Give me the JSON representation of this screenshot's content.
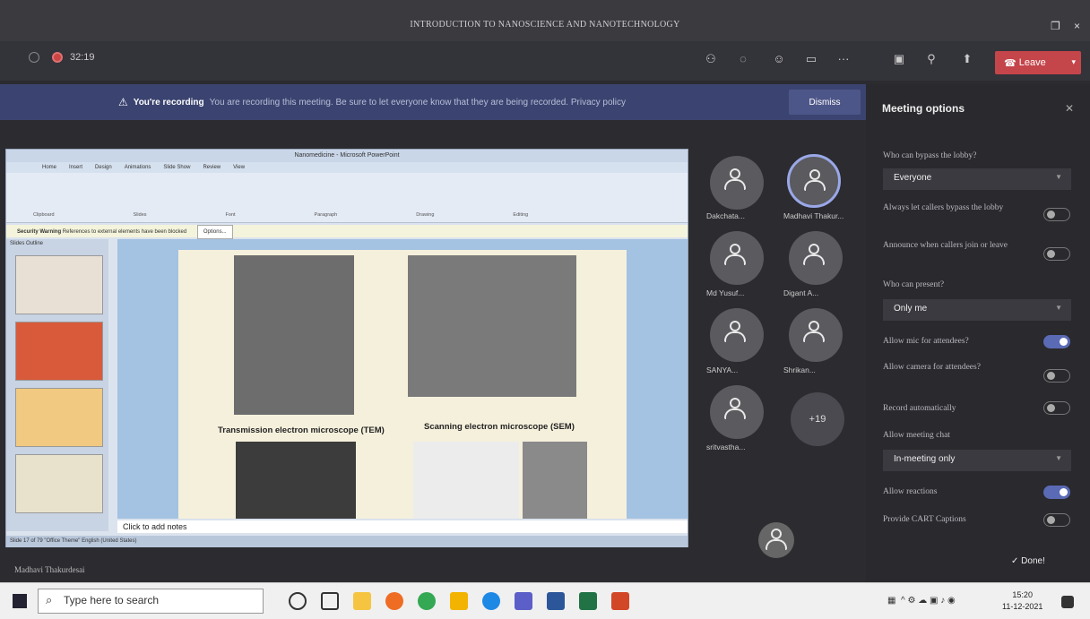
{
  "window": {
    "title": "INTRODUCTION TO NANOSCIENCE AND NANOTECHNOLOGY",
    "restore_icon": "restore-icon",
    "close_glyph": "×"
  },
  "toolbar": {
    "timer": "32:19",
    "leave_label": "Leave",
    "more_glyph": "···"
  },
  "banner": {
    "title": "You're recording",
    "message": "You are recording this meeting. Be sure to let everyone know that they are being recorded. Privacy policy",
    "dismiss": "Dismiss"
  },
  "ppt": {
    "title": "Nanomedicine - Microsoft PowerPoint",
    "tabs": [
      "Home",
      "Insert",
      "Design",
      "Animations",
      "Slide Show",
      "Review",
      "View"
    ],
    "groups": [
      "Clipboard",
      "Slides",
      "Font",
      "Paragraph",
      "Drawing",
      "Editing"
    ],
    "security_warning": "Security Warning",
    "security_message": "References to external elements have been blocked",
    "security_options": "Options...",
    "pane_tabs": "Slides  Outline",
    "caption_tem": "Transmission electron microscope (TEM)",
    "caption_sem": "Scanning electron microscope (SEM)",
    "notes_placeholder": "Click to add notes",
    "status": "Slide 17 of 79   \"Office Theme\"   English (United States)"
  },
  "participants": [
    {
      "name": "Dakchata..."
    },
    {
      "name": "Madhavi Thakur..."
    },
    {
      "name": "Md Yusuf..."
    },
    {
      "name": "Digant A..."
    },
    {
      "name": "SANYA..."
    },
    {
      "name": "Shrikan..."
    },
    {
      "name": "sritvastha..."
    }
  ],
  "more_count": "+19",
  "presenter_name": "Madhavi Thakurdesai",
  "options": {
    "title": "Meeting options",
    "bypass_label": "Who can bypass the lobby?",
    "bypass_value": "Everyone",
    "always_callers_label": "Always let callers bypass the lobby",
    "announce_label": "Announce when callers join or leave",
    "present_label": "Who can present?",
    "present_value": "Only me",
    "mic_label": "Allow mic for attendees?",
    "camera_label": "Allow camera for attendees?",
    "record_label": "Record automatically",
    "chat_label": "Allow meeting chat",
    "chat_value": "In-meeting only",
    "reactions_label": "Allow reactions",
    "cart_label": "Provide CART Captions",
    "done": "Done!",
    "mic_on": true,
    "reactions_on": true
  },
  "taskbar": {
    "search_placeholder": "Type here to search",
    "time": "15:20",
    "date": "11-12-2021"
  },
  "colors": {
    "leave": "#c4454a",
    "banner": "#3b4470",
    "toggle_on": "#5b6ab5"
  }
}
